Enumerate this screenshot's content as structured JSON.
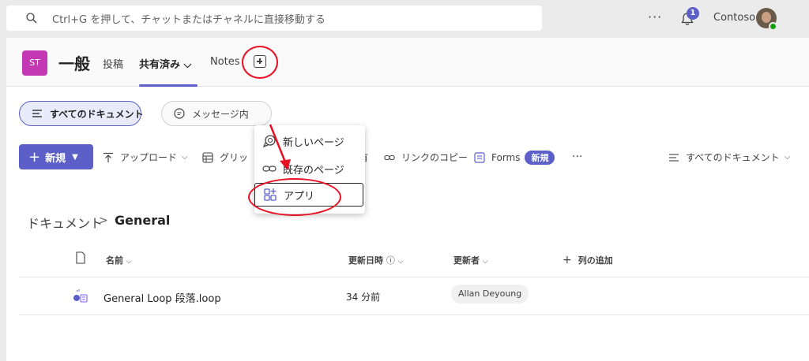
{
  "search": {
    "placeholder": "Ctrl+G を押して、チャットまたはチャネルに直接移動する"
  },
  "topbar": {
    "more": "···",
    "bell_badge": "1",
    "org": "Contoso"
  },
  "channel": {
    "team_initials": "ST",
    "title": "一般",
    "tabs": [
      {
        "label": "投稿"
      },
      {
        "label": "共有済み ⌵"
      },
      {
        "label": "Notes"
      }
    ]
  },
  "chips": {
    "all_docs": "すべてのドキュメント",
    "messages": "メッセージ内"
  },
  "toolbar": {
    "new_label": "新規",
    "upload": "アップロード",
    "grid": "グリッ",
    "share_tail": "有",
    "copy_link": "リンクのコピー",
    "forms": "Forms",
    "forms_badge": "新規",
    "more": "···",
    "view": "すべてのドキュメント"
  },
  "breadcrumb": {
    "root": "ドキュメント",
    "separator": ">",
    "current": "General"
  },
  "table": {
    "headers": {
      "name": "名前",
      "modified": "更新日時",
      "modified_by": "更新者",
      "add_column": "列の追加"
    },
    "rows": [
      {
        "name": "General Loop 段落.loop",
        "modified": "34 分前",
        "modified_by": "Allan Deyoung"
      }
    ]
  },
  "menu": {
    "items": [
      {
        "label": "新しいページ",
        "icon": "loop-page-icon"
      },
      {
        "label": "既存のページ",
        "icon": "link-icon"
      },
      {
        "label": "アプリ",
        "icon": "apps-add-icon"
      }
    ]
  },
  "colors": {
    "accent": "#5b5fc7",
    "annotation": "#e81123",
    "team": "#c239b3"
  }
}
